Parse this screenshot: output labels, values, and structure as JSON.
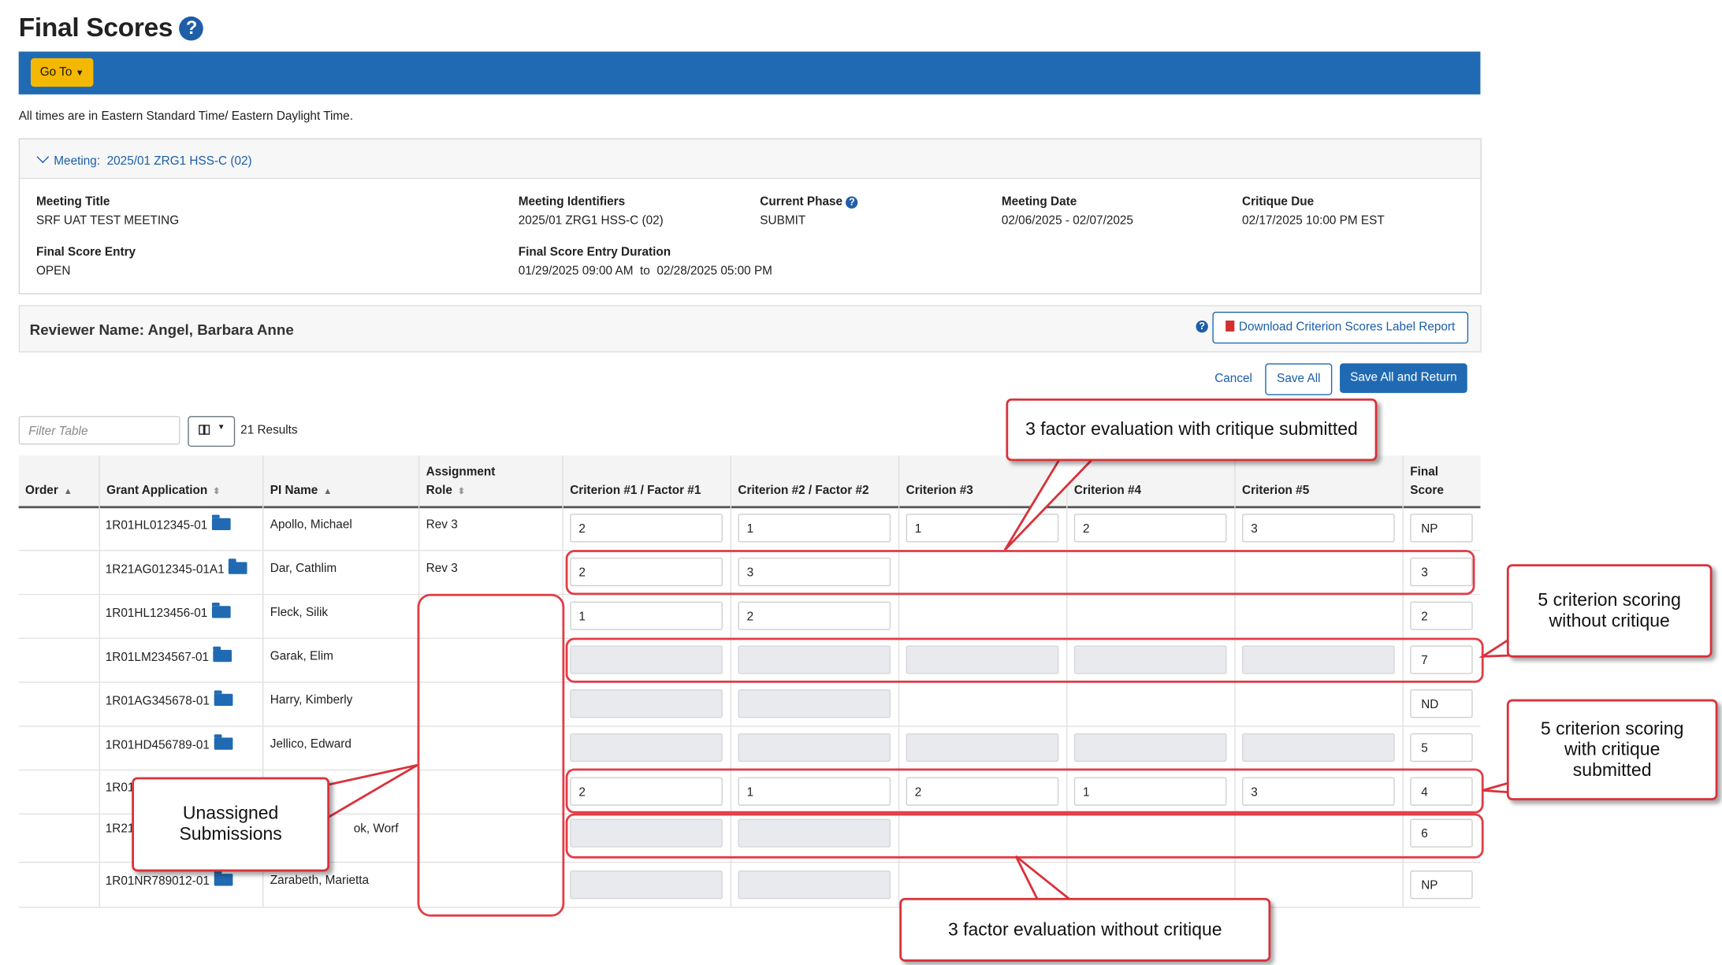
{
  "page": {
    "title": "Final Scores",
    "goto_label": "Go To",
    "timezone_note": "All times are in Eastern Standard Time/ Eastern Daylight Time."
  },
  "meeting": {
    "toggle_label": "Meeting:",
    "meeting_id": "2025/01 ZRG1 HSS-C (02)",
    "fields": {
      "title_label": "Meeting Title",
      "title_value": "SRF UAT TEST MEETING",
      "identifiers_label": "Meeting Identifiers",
      "identifiers_value": "2025/01 ZRG1 HSS-C (02)",
      "phase_label": "Current Phase",
      "phase_value": "SUBMIT",
      "date_label": "Meeting Date",
      "date_value": "02/06/2025 - 02/07/2025",
      "critique_label": "Critique Due",
      "critique_value": "02/17/2025 10:00 PM EST",
      "fse_label": "Final Score Entry",
      "fse_value": "OPEN",
      "duration_label": "Final Score Entry Duration",
      "duration_start": "01/29/2025 09:00 AM",
      "duration_to": "to",
      "duration_end": "02/28/2025 05:00 PM"
    }
  },
  "reviewer": {
    "name": "Reviewer Name: Angel, Barbara Anne",
    "download_label": "Download Criterion Scores Label Report"
  },
  "actions": {
    "cancel": "Cancel",
    "save_all": "Save All",
    "save_return": "Save All and Return"
  },
  "table_tools": {
    "filter_placeholder": "Filter Table",
    "results": "21 Results"
  },
  "columns": {
    "order": "Order",
    "grant": "Grant Application",
    "pi": "PI Name",
    "role_1": "Assignment",
    "role_2": "Role",
    "c1": "Criterion #1 / Factor #1",
    "c2": "Criterion #2 / Factor #2",
    "c3": "Criterion #3",
    "c4": "Criterion #4",
    "c5": "Criterion #5",
    "final_1": "Final",
    "final_2": "Score"
  },
  "rows": [
    {
      "grant": "1R01HL012345-01",
      "pi": "Apollo, Michael",
      "role": "Rev 3",
      "c1": "2",
      "c2": "1",
      "c3": "1",
      "c4": "2",
      "c5": "3",
      "final": "NP"
    },
    {
      "grant": "1R21AG012345-01A1",
      "pi": "Dar, Cathlim",
      "role": "Rev 3",
      "c1": "2",
      "c2": "3",
      "final": "3"
    },
    {
      "grant": "1R01HL123456-01",
      "pi": "Fleck, Silik",
      "role": "",
      "c1": "1",
      "c2": "2",
      "final": "2"
    },
    {
      "grant": "1R01LM234567-01",
      "pi": "Garak, Elim",
      "role": "",
      "final": "7"
    },
    {
      "grant": "1R01AG345678-01",
      "pi": "Harry, Kimberly",
      "role": "",
      "final": "ND"
    },
    {
      "grant": "1R01HD456789-01",
      "pi": "Jellico, Edward",
      "role": "",
      "final": "5"
    },
    {
      "grant": "1R01",
      "pi": "",
      "role": "",
      "c1": "2",
      "c2": "1",
      "c3": "2",
      "c4": "1",
      "c5": "3",
      "final": "4"
    },
    {
      "grant": "1R21",
      "pi": "ok, Worf",
      "role": "",
      "final": "6"
    },
    {
      "grant": "1R01NR789012-01",
      "pi": "Zarabeth, Marietta",
      "role": "",
      "final": "NP"
    }
  ],
  "callouts": {
    "three_factor_with": "3 factor evaluation with critique submitted",
    "five_without": "5 criterion scoring without critique",
    "five_with": "5 criterion scoring with critique submitted",
    "unassigned": "Unassigned Submissions",
    "three_factor_without": "3 factor evaluation without critique"
  }
}
